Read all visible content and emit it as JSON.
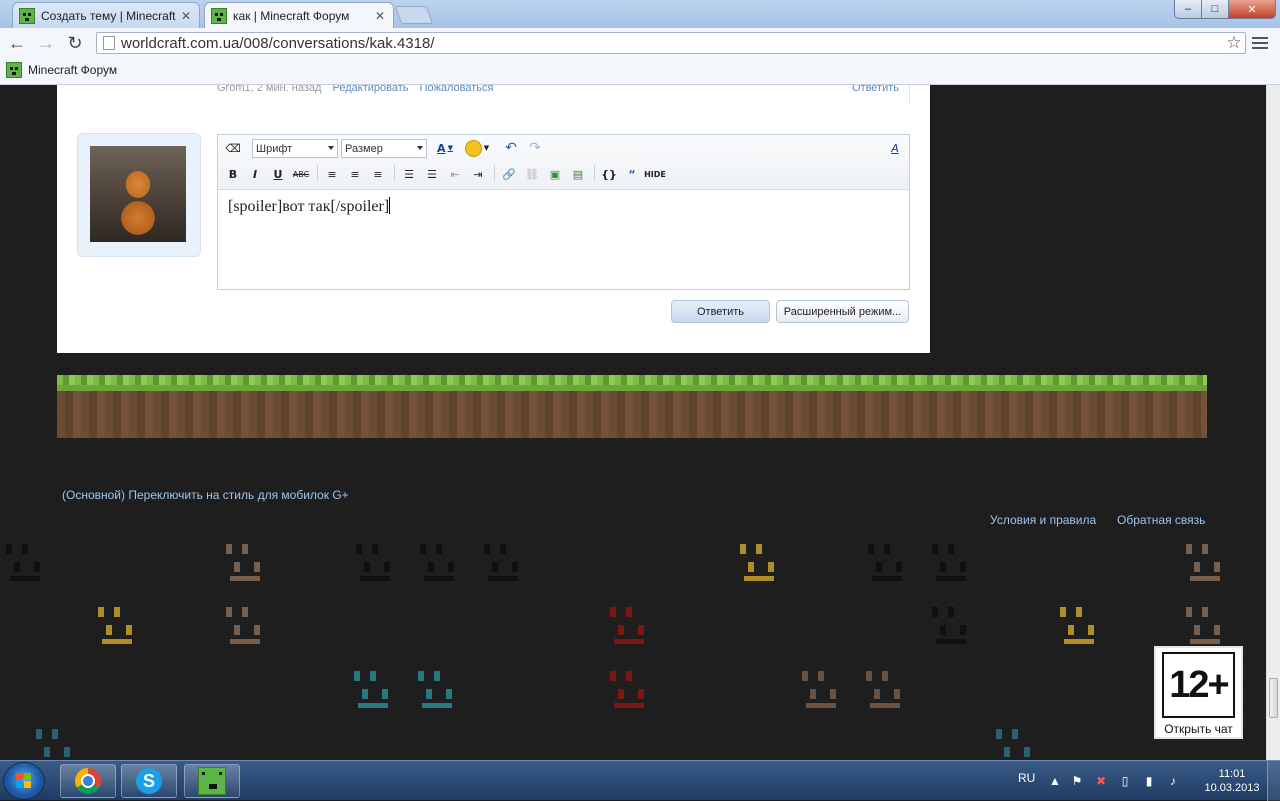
{
  "browser": {
    "tabs": [
      {
        "title": "Создать тему | Minecraft Форум",
        "active": false
      },
      {
        "title": "как | Minecraft Форум",
        "active": true
      }
    ],
    "url_host": "worldcraft.com.ua",
    "url_path": "/008/conversations/kak.4318/",
    "url_full": "worldcraft.com.ua/008/conversations/kak.4318/",
    "bookmark_label": "Minecraft Форум",
    "window_buttons": {
      "minimize": "–",
      "maximize": "□",
      "close": "✕"
    }
  },
  "previous_message": {
    "meta": "Grom1, 2 мин. назад",
    "edit_label": "Редактировать",
    "report_label": "Пожаловаться",
    "reply_label": "Ответить"
  },
  "editor": {
    "font_select": "Шрифт",
    "size_select": "Размер",
    "text": "[spoiler]вот так[/spoiler]",
    "toolbar_labels": {
      "bold": "B",
      "italic": "I",
      "underline": "U",
      "strike": "ABC",
      "hide": "HIDE",
      "font_color": "A",
      "source": "A"
    }
  },
  "buttons": {
    "reply": "Ответить",
    "advanced": "Расширенный режим..."
  },
  "footer": {
    "style_link": "(Основной)",
    "mobile_link": "Переключить на стиль для мобилок",
    "gplus_link": "G+",
    "terms_link": "Условия и правила",
    "feedback_link": "Обратная связь"
  },
  "age_badge": {
    "rating": "12+",
    "chat_label": "Открыть чат"
  },
  "taskbar": {
    "language": "RU",
    "time": "11:01",
    "date": "10.03.2013"
  },
  "colors": {
    "link": "#5a8cc0",
    "footer_link": "#9fc4ec",
    "grass": "#6ca53a",
    "dirt": "#614530",
    "taskbar": "#2a4a75"
  }
}
